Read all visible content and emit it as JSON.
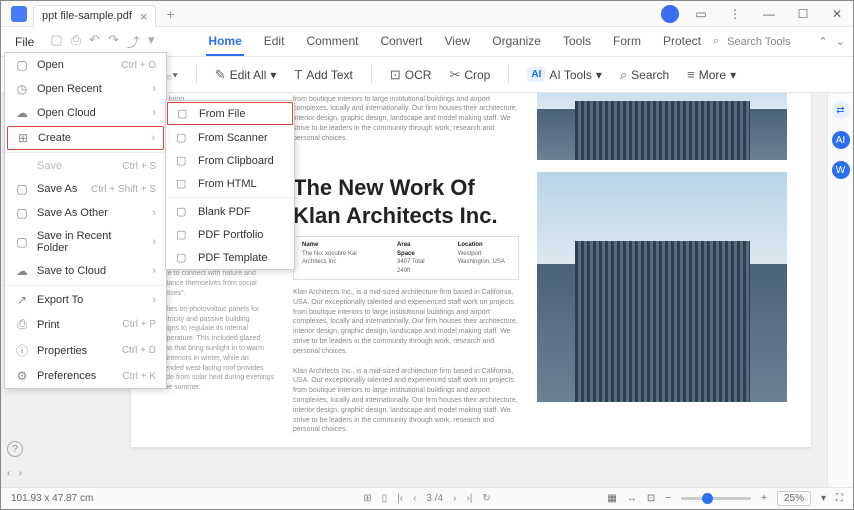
{
  "titlebar": {
    "filename": "ppt file-sample.pdf"
  },
  "menubar": {
    "file": "File"
  },
  "tabs": [
    "Home",
    "Edit",
    "Comment",
    "Convert",
    "View",
    "Organize",
    "Tools",
    "Form",
    "Protect"
  ],
  "active_tab": "Home",
  "search_placeholder": "Search Tools",
  "toolbar": {
    "edit_all": "Edit All",
    "add_text": "Add Text",
    "ocr": "OCR",
    "crop": "Crop",
    "ai_tools": "AI Tools",
    "search": "Search",
    "more": "More"
  },
  "file_menu": [
    {
      "icon": "▢",
      "label": "Open",
      "shortcut": "Ctrl + O",
      "arrow": false
    },
    {
      "icon": "◷",
      "label": "Open Recent",
      "arrow": true
    },
    {
      "icon": "☁",
      "label": "Open Cloud",
      "arrow": true
    },
    {
      "icon": "⊞",
      "label": "Create",
      "arrow": true,
      "selected": true
    },
    {
      "icon": "",
      "label": "Save",
      "shortcut": "Ctrl + S",
      "disabled": true
    },
    {
      "icon": "▢",
      "label": "Save As",
      "shortcut": "Ctrl + Shift + S"
    },
    {
      "icon": "▢",
      "label": "Save As Other",
      "arrow": true
    },
    {
      "icon": "▢",
      "label": "Save in Recent Folder",
      "arrow": true
    },
    {
      "icon": "☁",
      "label": "Save to Cloud",
      "arrow": true
    },
    {
      "icon": "↗",
      "label": "Export To",
      "arrow": true
    },
    {
      "icon": "⎙",
      "label": "Print",
      "shortcut": "Ctrl + P"
    },
    {
      "icon": "ⓘ",
      "label": "Properties",
      "shortcut": "Ctrl + D"
    },
    {
      "icon": "⚙",
      "label": "Preferences",
      "shortcut": "Ctrl + K"
    }
  ],
  "create_submenu": [
    {
      "icon": "▢",
      "label": "From File",
      "hl": true
    },
    {
      "icon": "▢",
      "label": "From Scanner"
    },
    {
      "icon": "▢",
      "label": "From Clipboard"
    },
    {
      "icon": "▢",
      "label": "From HTML"
    },
    {
      "icon": "▢",
      "label": "Blank PDF"
    },
    {
      "icon": "▢",
      "label": "PDF Portfolio"
    },
    {
      "icon": "▢",
      "label": "PDF Template"
    }
  ],
  "document": {
    "title1": "The New Work Of",
    "title2": "Klan Architects Inc.",
    "info": {
      "name_h": "Name",
      "name_v": "The Nu: xocubre Kal Architecs Inc",
      "area_h": "Area Space",
      "area_v": "3407 Total 240ft",
      "loc_h": "Location",
      "loc_v": "Westport Washington, USA"
    },
    "para1": "Klan Architects Inc., is a mid-sized architecture firm based in California, USA. Our exceptionally talented and experienced staff work on projects from boutique interiors to large institutional buildings and airport complexes, locally and internationally. Our firm houses their architecture, interior design, graphic design, landscape and model making staff. We strive to be leaders in the community through work, research and personal choices.",
    "para2": "Klan Architects Inc., is a mid-sized architecture firm based in California, USA. Our exceptionally talented and experienced staff work on projects from boutique interiors to large institutional buildings and airport complexes, locally and internationally. Our firm houses their architecture, interior design, graphic design, landscape and model making staff. We strive to be leaders in the community through work, research and personal choices.",
    "side1": "Khan Architects Inc., created this off-grid retreat in Westport, Washington for a family looking for an isolated place to connect with nature and \"distance themselves from social stresses\".",
    "side2": "It relies on photovoltaic panels for electricity and passive building designs to regulate its internal temperature. This included glazed areas that bring sunlight in to warm the interiors in winter, while an extended west-facing roof provides shade from solar heat during evenings in the summer."
  },
  "status": {
    "coords": "101.93 x 47.87 cm",
    "page": "3 /4",
    "zoom": "25%"
  }
}
